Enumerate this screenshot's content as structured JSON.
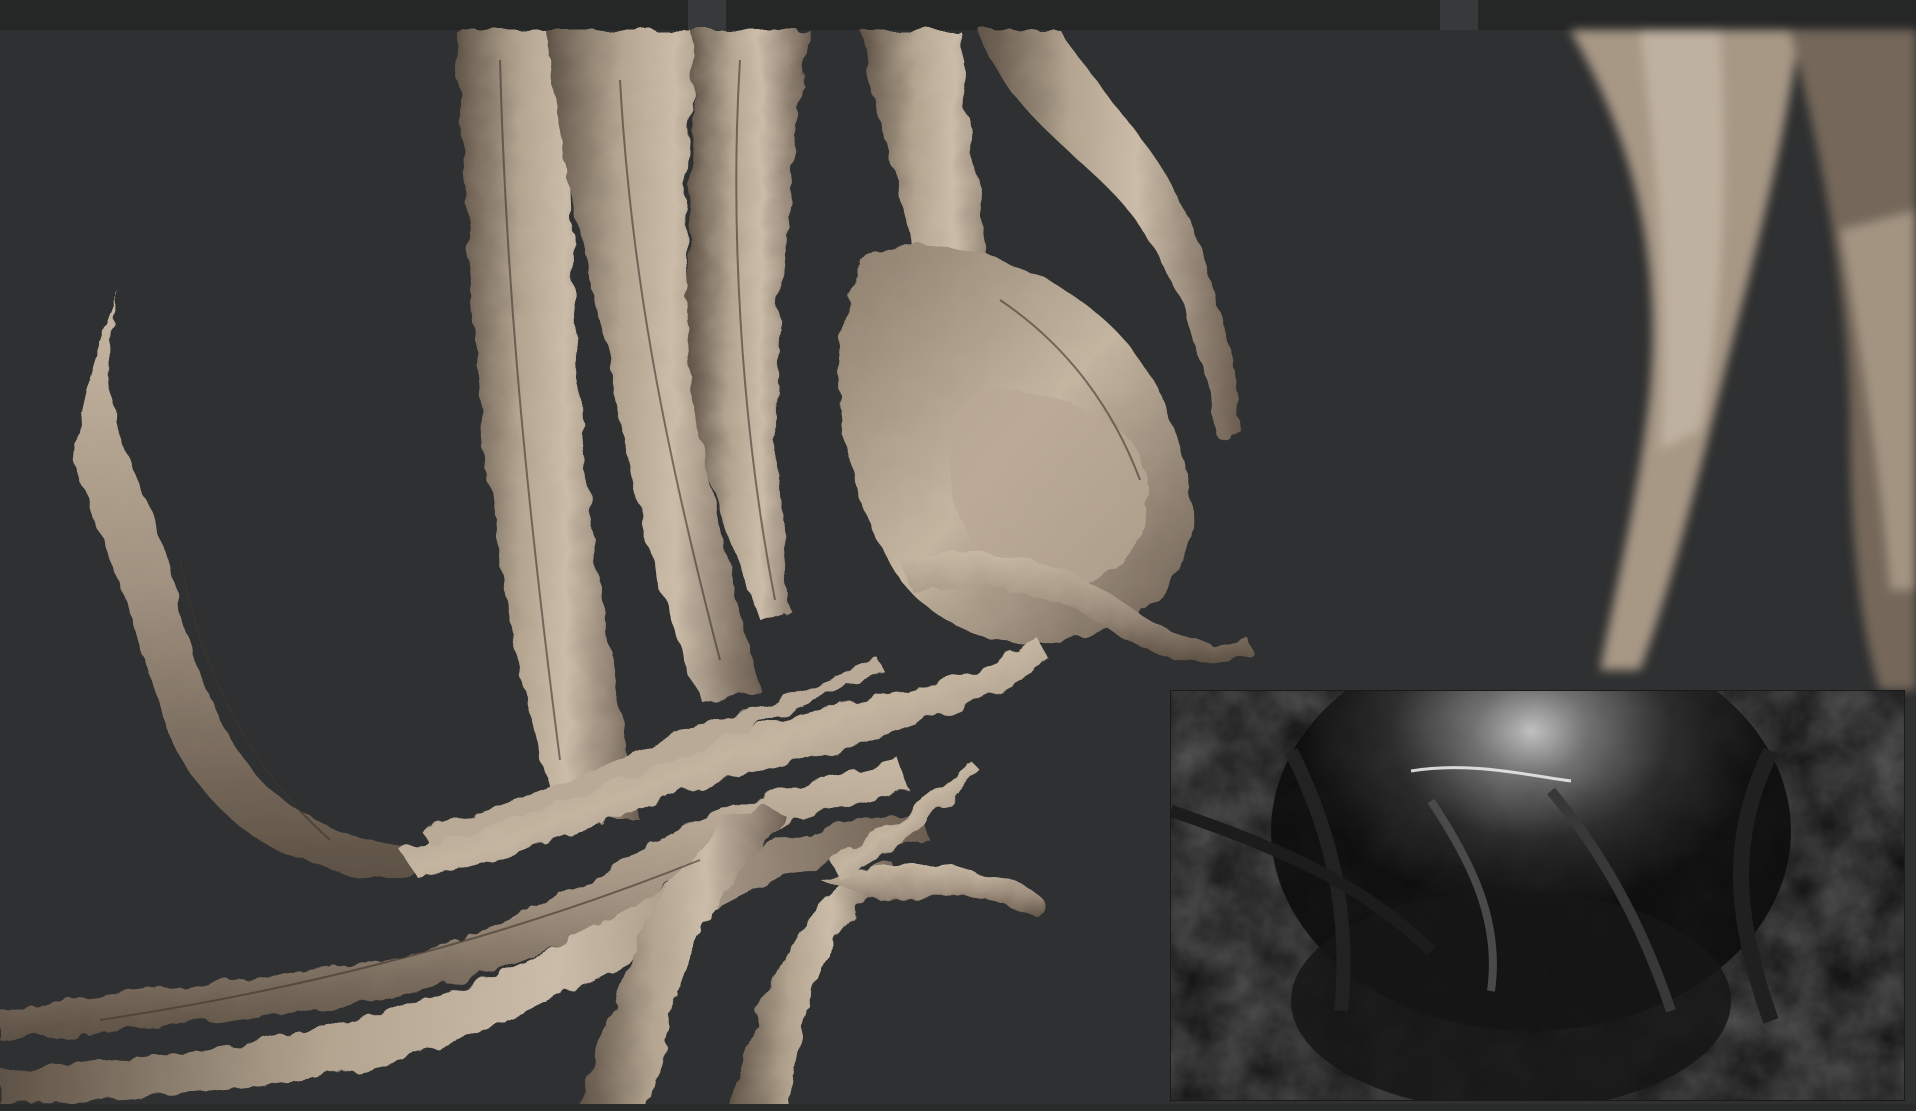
{
  "window": {
    "title": ""
  },
  "viewport": {
    "main_sculpt": "root-sculpt-render",
    "closeup": "root-closeup-render",
    "thumbnail": "cave-lit-render"
  },
  "colors": {
    "background": "#2f3031",
    "clay": "#a69684",
    "clay_shadow": "#5e5246",
    "clay_highlight": "#cfc2b2",
    "thumb_bg": "#0b0b0b"
  }
}
